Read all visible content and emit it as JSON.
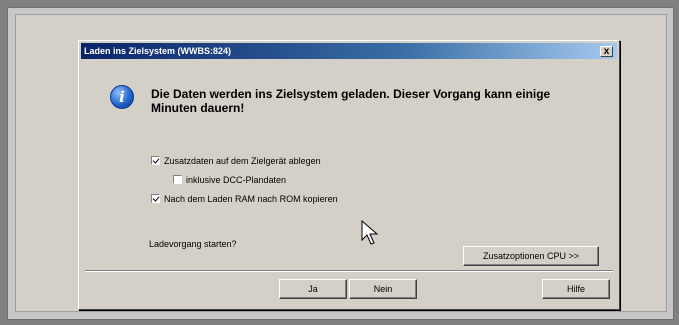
{
  "dialog": {
    "title": "Laden ins Zielsystem (WWBS:824)",
    "close_label": "x",
    "message": "Die Daten werden ins Zielsystem geladen. Dieser Vorgang kann einige Minuten dauern!",
    "icon": "info-icon",
    "options": [
      {
        "label": "Zusatzdaten auf dem Zielgerät ablegen",
        "checked": true
      },
      {
        "label": "inklusive DCC-Plandaten",
        "checked": false
      },
      {
        "label": "Nach dem Laden RAM nach ROM kopieren",
        "checked": true
      }
    ],
    "prompt": "Ladevorgang starten?",
    "buttons": {
      "extra": "Zusatzoptionen CPU >>",
      "yes": "Ja",
      "no": "Nein",
      "help": "Hilfe"
    }
  }
}
